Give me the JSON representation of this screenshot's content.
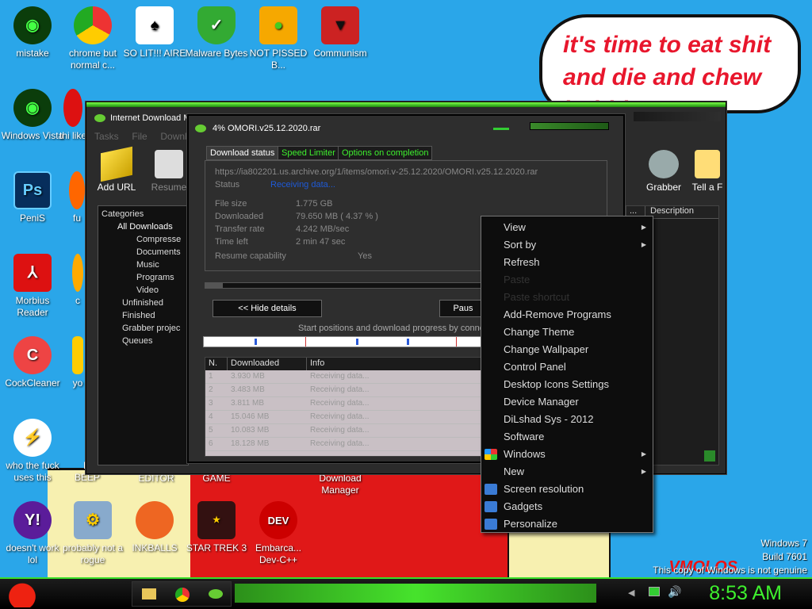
{
  "desktop": {
    "bubble_text": "it's time to eat shit and die and chew bubble gum",
    "icons": [
      {
        "label": "mistake",
        "icon": "green-eye-icon"
      },
      {
        "label": "chrome but normal c...",
        "icon": "chrome-icon"
      },
      {
        "label": "SO LIT!!! AIRE",
        "icon": "solitaire-icon"
      },
      {
        "label": "Malware Bytes",
        "icon": "shield-icon"
      },
      {
        "label": "NOT PISSED B...",
        "icon": "angry-pig-icon"
      },
      {
        "label": "Communism",
        "icon": "emblem-icon"
      },
      {
        "label": "Windows Vista",
        "icon": "green-eye-icon"
      },
      {
        "label": "thi like",
        "icon": "opera-icon"
      },
      {
        "label": "PeniS",
        "icon": "photoshop-icon"
      },
      {
        "label": "fu",
        "icon": "firefox-icon"
      },
      {
        "label": "Morbius Reader",
        "icon": "acrobat-icon"
      },
      {
        "label": "c",
        "icon": "generic-icon"
      },
      {
        "label": "CockCleaner",
        "icon": "ccleaner-icon"
      },
      {
        "label": "yo",
        "icon": "generic-icon"
      },
      {
        "label": "who the fuck uses this",
        "icon": "lightning-icon"
      },
      {
        "label": "B BEEP",
        "icon": "generic-icon"
      },
      {
        "label": "EDITOR",
        "icon": "generic-icon"
      },
      {
        "label": "GAME",
        "icon": "generic-icon"
      },
      {
        "label": "Download Manager",
        "icon": "idm-icon"
      },
      {
        "label": "doesn't work lol",
        "icon": "yahoo-icon"
      },
      {
        "label": "probably not a rogue",
        "icon": "gears-icon"
      },
      {
        "label": "INKBALLS",
        "icon": "inkball-icon"
      },
      {
        "label": "STAR TREK 3",
        "icon": "starwars-icon"
      },
      {
        "label": "Embarca... Dev-C++",
        "icon": "devcpp-icon"
      }
    ]
  },
  "idm": {
    "title": "Internet Download M",
    "menus": [
      "Tasks",
      "File",
      "Downl"
    ],
    "toolbar": {
      "add_url": "Add URL",
      "resume": "Resume",
      "grabber": "Grabber",
      "tell_a_friend": "Tell a F"
    },
    "categories_title": "Categories",
    "categories": [
      "All Downloads",
      "Compresse",
      "Documents",
      "Music",
      "Programs",
      "Video",
      "Unfinished",
      "Finished",
      "Grabber projec",
      "Queues"
    ],
    "columns": [
      "...",
      "Description"
    ]
  },
  "dialog": {
    "title": "4% OMORI.v25.12.2020.rar",
    "tabs": [
      "Download status",
      "Speed Limiter",
      "Options on completion"
    ],
    "url": "https://ia802201.us.archive.org/1/items/omori.v-25.12.2020/OMORI.v25.12.2020.rar",
    "status_label": "Status",
    "status_value": "Receiving data...",
    "file_size_label": "File size",
    "file_size": "1.775  GB",
    "downloaded_label": "Downloaded",
    "downloaded": "79.650  MB  ( 4.37 % )",
    "rate_label": "Transfer rate",
    "rate": "4.242  MB/sec",
    "time_left_label": "Time left",
    "time_left": "2 min 47 sec",
    "resume_label": "Resume capability",
    "resume": "Yes",
    "hide_details": "<< Hide details",
    "pause": "Paus",
    "progress_caption": "Start positions and download progress by conne",
    "table_headers": [
      "N.",
      "Downloaded",
      "Info"
    ],
    "rows": [
      {
        "n": "1",
        "dl": "3.930  MB",
        "info": "Receiving data..."
      },
      {
        "n": "2",
        "dl": "3.483  MB",
        "info": "Receiving data..."
      },
      {
        "n": "3",
        "dl": "3.811  MB",
        "info": "Receiving data..."
      },
      {
        "n": "4",
        "dl": "15.046  MB",
        "info": "Receiving data..."
      },
      {
        "n": "5",
        "dl": "10.083  MB",
        "info": "Receiving data..."
      },
      {
        "n": "6",
        "dl": "18.128  MB",
        "info": "Receiving data..."
      }
    ]
  },
  "context_menu": {
    "items": [
      {
        "label": "View",
        "sub": true
      },
      {
        "label": "Sort by",
        "sub": true
      },
      {
        "label": "Refresh"
      },
      {
        "label": "Paste",
        "disabled": true
      },
      {
        "label": "Paste shortcut",
        "disabled": true
      },
      {
        "label": "Add-Remove Programs"
      },
      {
        "label": "Change Theme"
      },
      {
        "label": "Change Wallpaper"
      },
      {
        "label": "Control Panel"
      },
      {
        "label": "Desktop Icons Settings"
      },
      {
        "label": "Device Manager"
      },
      {
        "label": "DiLshad Sys - 2012"
      },
      {
        "label": "Software"
      },
      {
        "label": "Windows",
        "sub": true,
        "icon": "windows-flag-icon"
      },
      {
        "label": "New",
        "sub": true
      },
      {
        "label": "Screen resolution",
        "icon": "monitor-icon"
      },
      {
        "label": "Gadgets",
        "icon": "gadgets-icon"
      },
      {
        "label": "Personalize",
        "icon": "personalize-icon"
      }
    ]
  },
  "watermark": {
    "line1": "Windows 7",
    "line2": "Build 7601",
    "line3": "This copy of Windows is not genuine",
    "brand": "VMOLOS"
  },
  "taskbar": {
    "clock": "8:53 AM"
  }
}
